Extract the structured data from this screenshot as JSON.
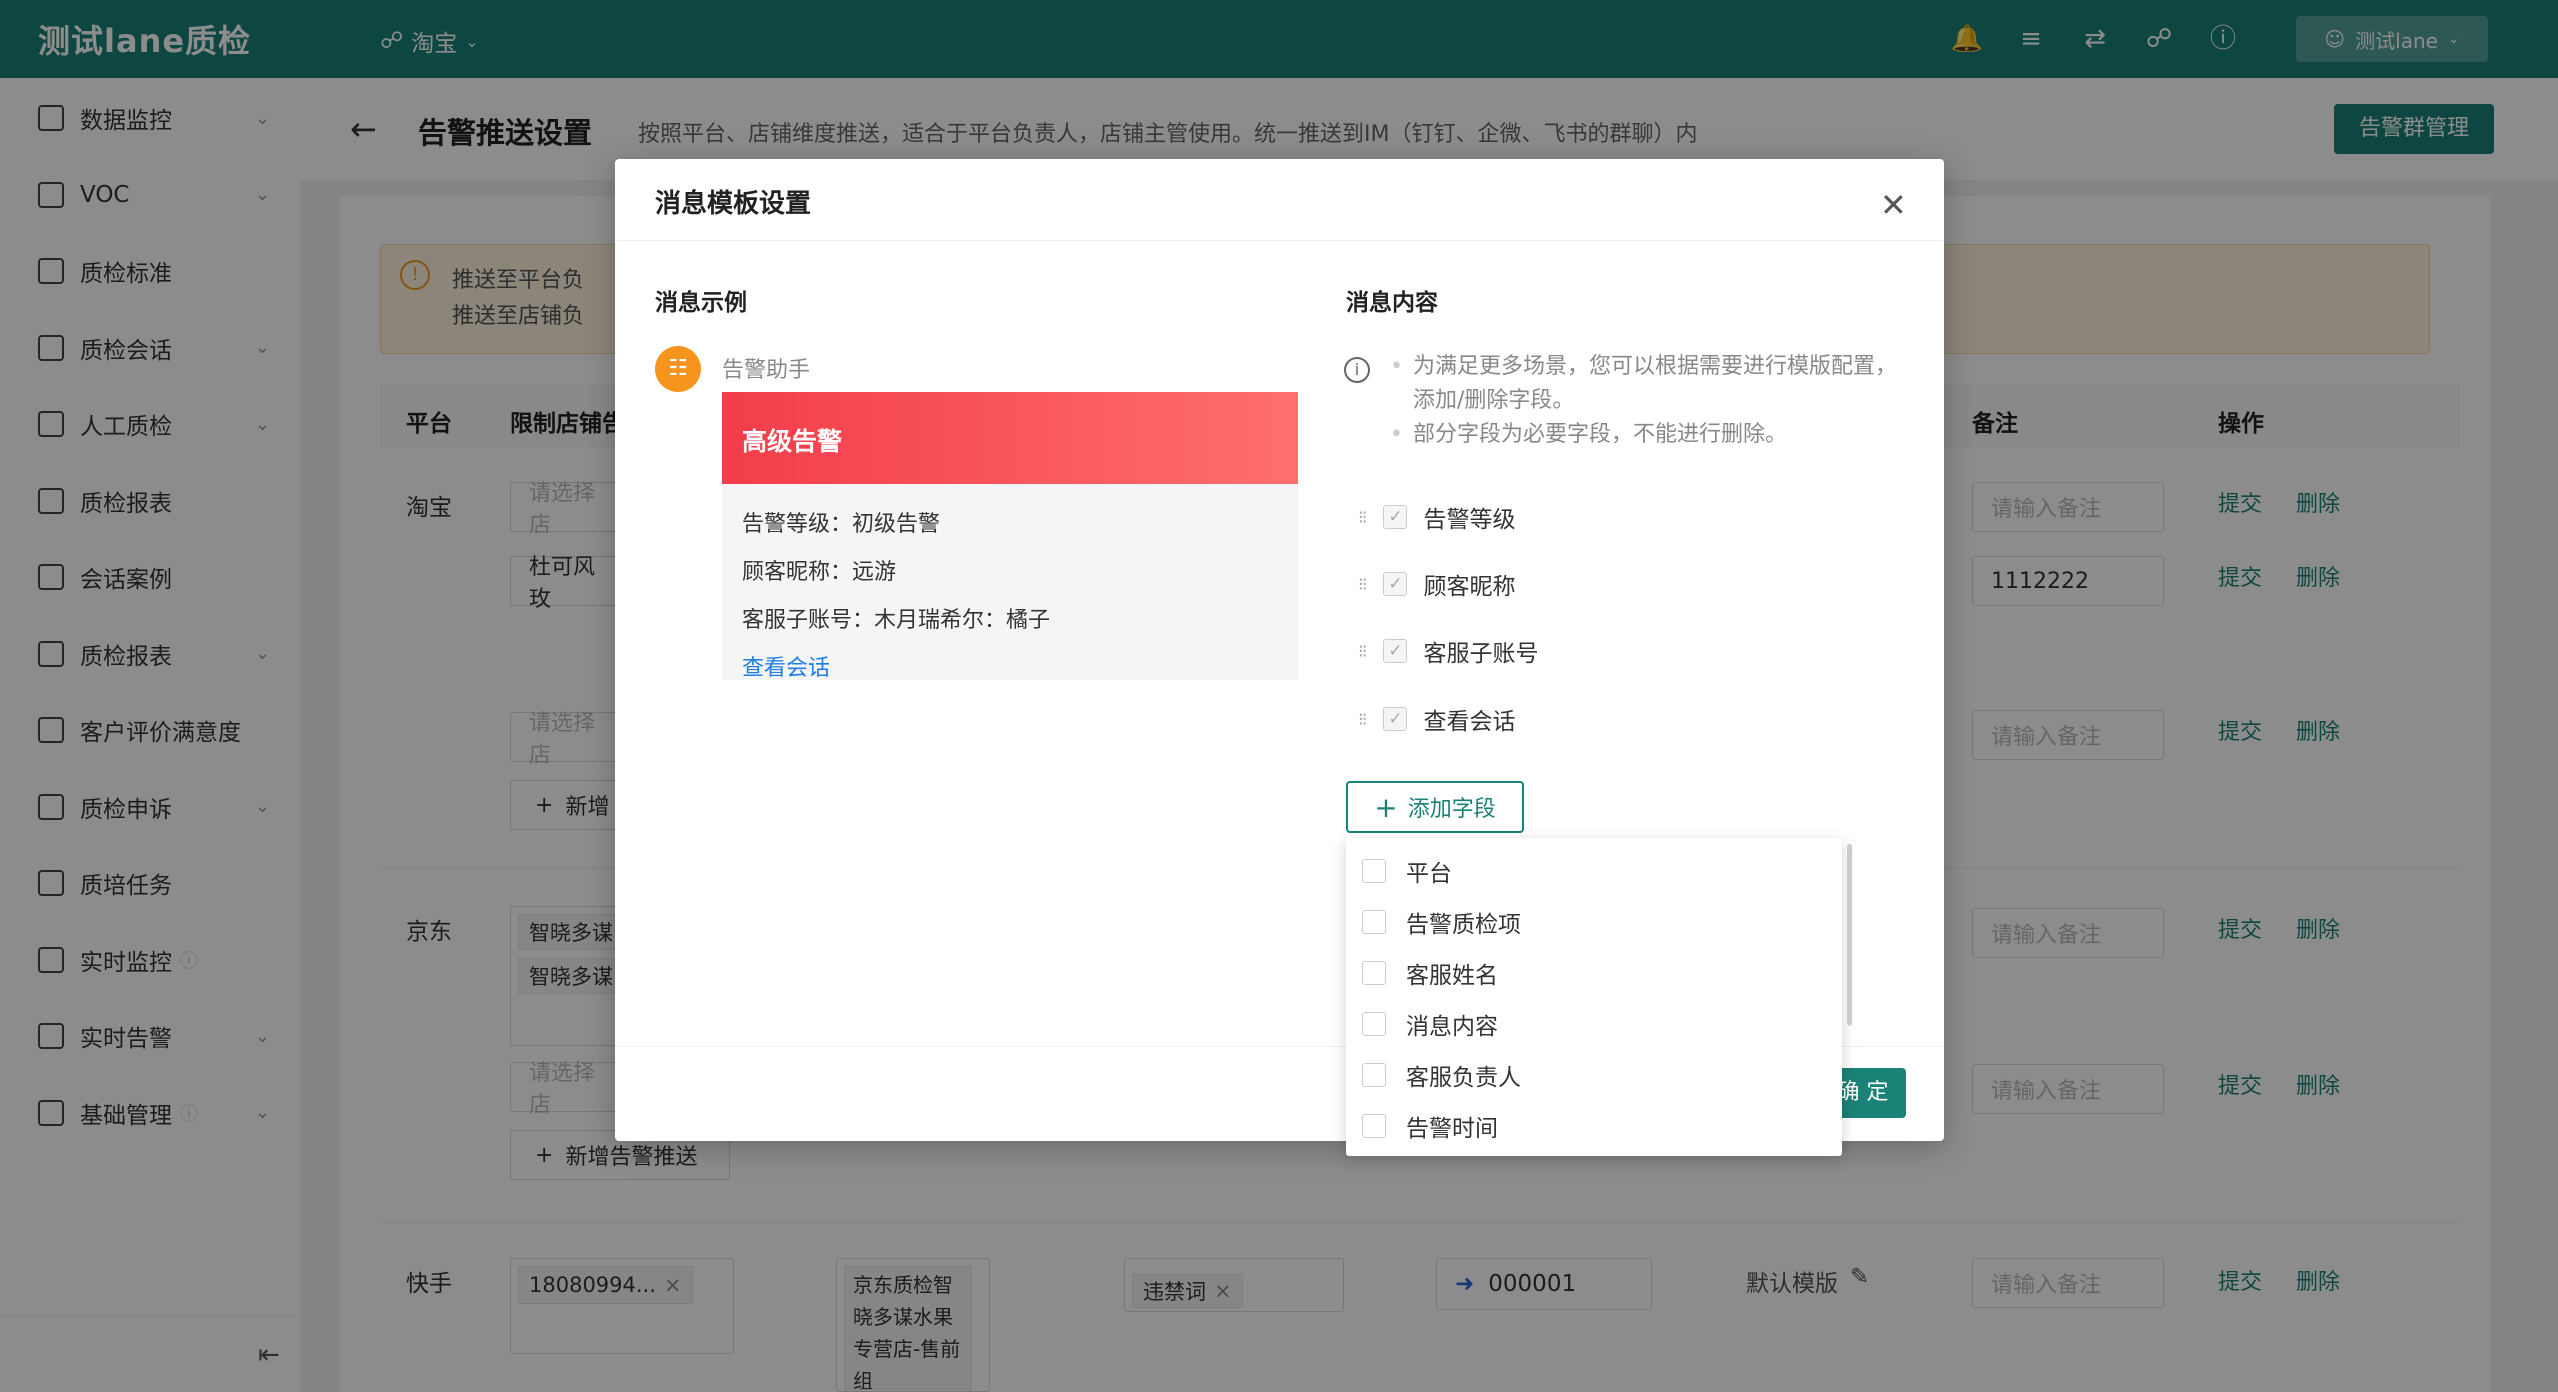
{
  "header": {
    "brand": "测试lane质检",
    "shop": "淘宝",
    "user": "测试lane",
    "icons": [
      "bell-icon",
      "list-icon",
      "swap-icon",
      "headset-icon",
      "help-icon"
    ]
  },
  "sidebar": {
    "items": [
      {
        "label": "数据监控",
        "chevron": true,
        "info": false
      },
      {
        "label": "VOC",
        "chevron": true,
        "info": false
      },
      {
        "label": "质检标准",
        "chevron": false,
        "info": false
      },
      {
        "label": "质检会话",
        "chevron": true,
        "info": false
      },
      {
        "label": "人工质检",
        "chevron": true,
        "info": false
      },
      {
        "label": "质检报表",
        "chevron": false,
        "info": false
      },
      {
        "label": "会话案例",
        "chevron": false,
        "info": false
      },
      {
        "label": "质检报表",
        "chevron": true,
        "info": false
      },
      {
        "label": "客户评价满意度",
        "chevron": false,
        "info": false
      },
      {
        "label": "质检申诉",
        "chevron": true,
        "info": false
      },
      {
        "label": "质培任务",
        "chevron": false,
        "info": false
      },
      {
        "label": "实时监控",
        "chevron": false,
        "info": true
      },
      {
        "label": "实时告警",
        "chevron": true,
        "info": false
      },
      {
        "label": "基础管理",
        "chevron": true,
        "info": true
      }
    ]
  },
  "page": {
    "title": "告警推送设置",
    "description": "按照平台、店铺维度推送，适合于平台负责人，店铺主管使用。统一推送到IM（钉钉、企微、飞书的群聊）内",
    "group_button": "告警群管理",
    "notice": [
      "推送至平台负",
      "推送至店铺负"
    ]
  },
  "table": {
    "headers": {
      "platform": "平台",
      "shop": "限制店铺告",
      "remark": "备注",
      "action": "操作"
    },
    "platforms": {
      "taobao": "淘宝",
      "jd": "京东",
      "ks": "快手"
    },
    "shop_placeholder": "请选择店",
    "remark_placeholder": "请输入备注",
    "remark_value": "1112222",
    "tag_dukefeng": "杜可风玫",
    "tag_zhixiao1": "智晓多谋",
    "tag_zhixiao2": "智晓多谋",
    "add_push": "新增告警推送",
    "add_short": "新增",
    "submit": "提交",
    "delete": "删除",
    "ks_account": "18080994...",
    "ks_shop": "京东质检智晓多谋水果专营店-售前组",
    "ks_keyword": "违禁词",
    "ks_code": "000001",
    "ks_template": "默认模版"
  },
  "modal": {
    "title": "消息模板设置",
    "example_title": "消息示例",
    "content_title": "消息内容",
    "bot_name": "告警助手",
    "alert_level_banner": "高级告警",
    "example_rows": [
      "告警等级：初级告警",
      "顾客昵称：远游",
      "客服子账号：木月瑞希尔：橘子"
    ],
    "example_link": "查看会话",
    "notes": [
      "为满足更多场景，您可以根据需要进行模版配置，添加/删除字段。",
      "部分字段为必要字段，不能进行删除。"
    ],
    "fields": [
      "告警等级",
      "顾客昵称",
      "客服子账号",
      "查看会话"
    ],
    "add_field": "添加字段",
    "ok_button": "确 定",
    "dropdown_options": [
      "平台",
      "告警质检项",
      "客服姓名",
      "消息内容",
      "客服负责人",
      "告警时间"
    ]
  }
}
